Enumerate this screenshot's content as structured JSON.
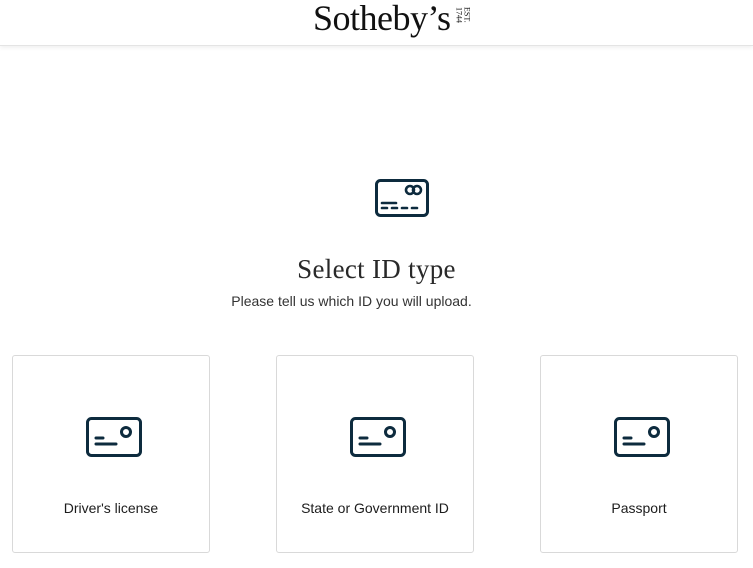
{
  "header": {
    "logo_text": "Sotheby’s",
    "logo_est": "EST. 1744"
  },
  "main": {
    "title": "Select ID type",
    "subtitle": "Please tell us which ID you will upload.",
    "hero_icon": "credit-card-icon"
  },
  "options": [
    {
      "label": "Driver's license",
      "icon": "id-card-icon"
    },
    {
      "label": "State or Government ID",
      "icon": "id-card-icon"
    },
    {
      "label": "Passport",
      "icon": "id-card-icon"
    }
  ],
  "colors": {
    "icon": "#0d2b3e",
    "card_border": "#d9d9d9",
    "text": "#1c1c1c"
  }
}
